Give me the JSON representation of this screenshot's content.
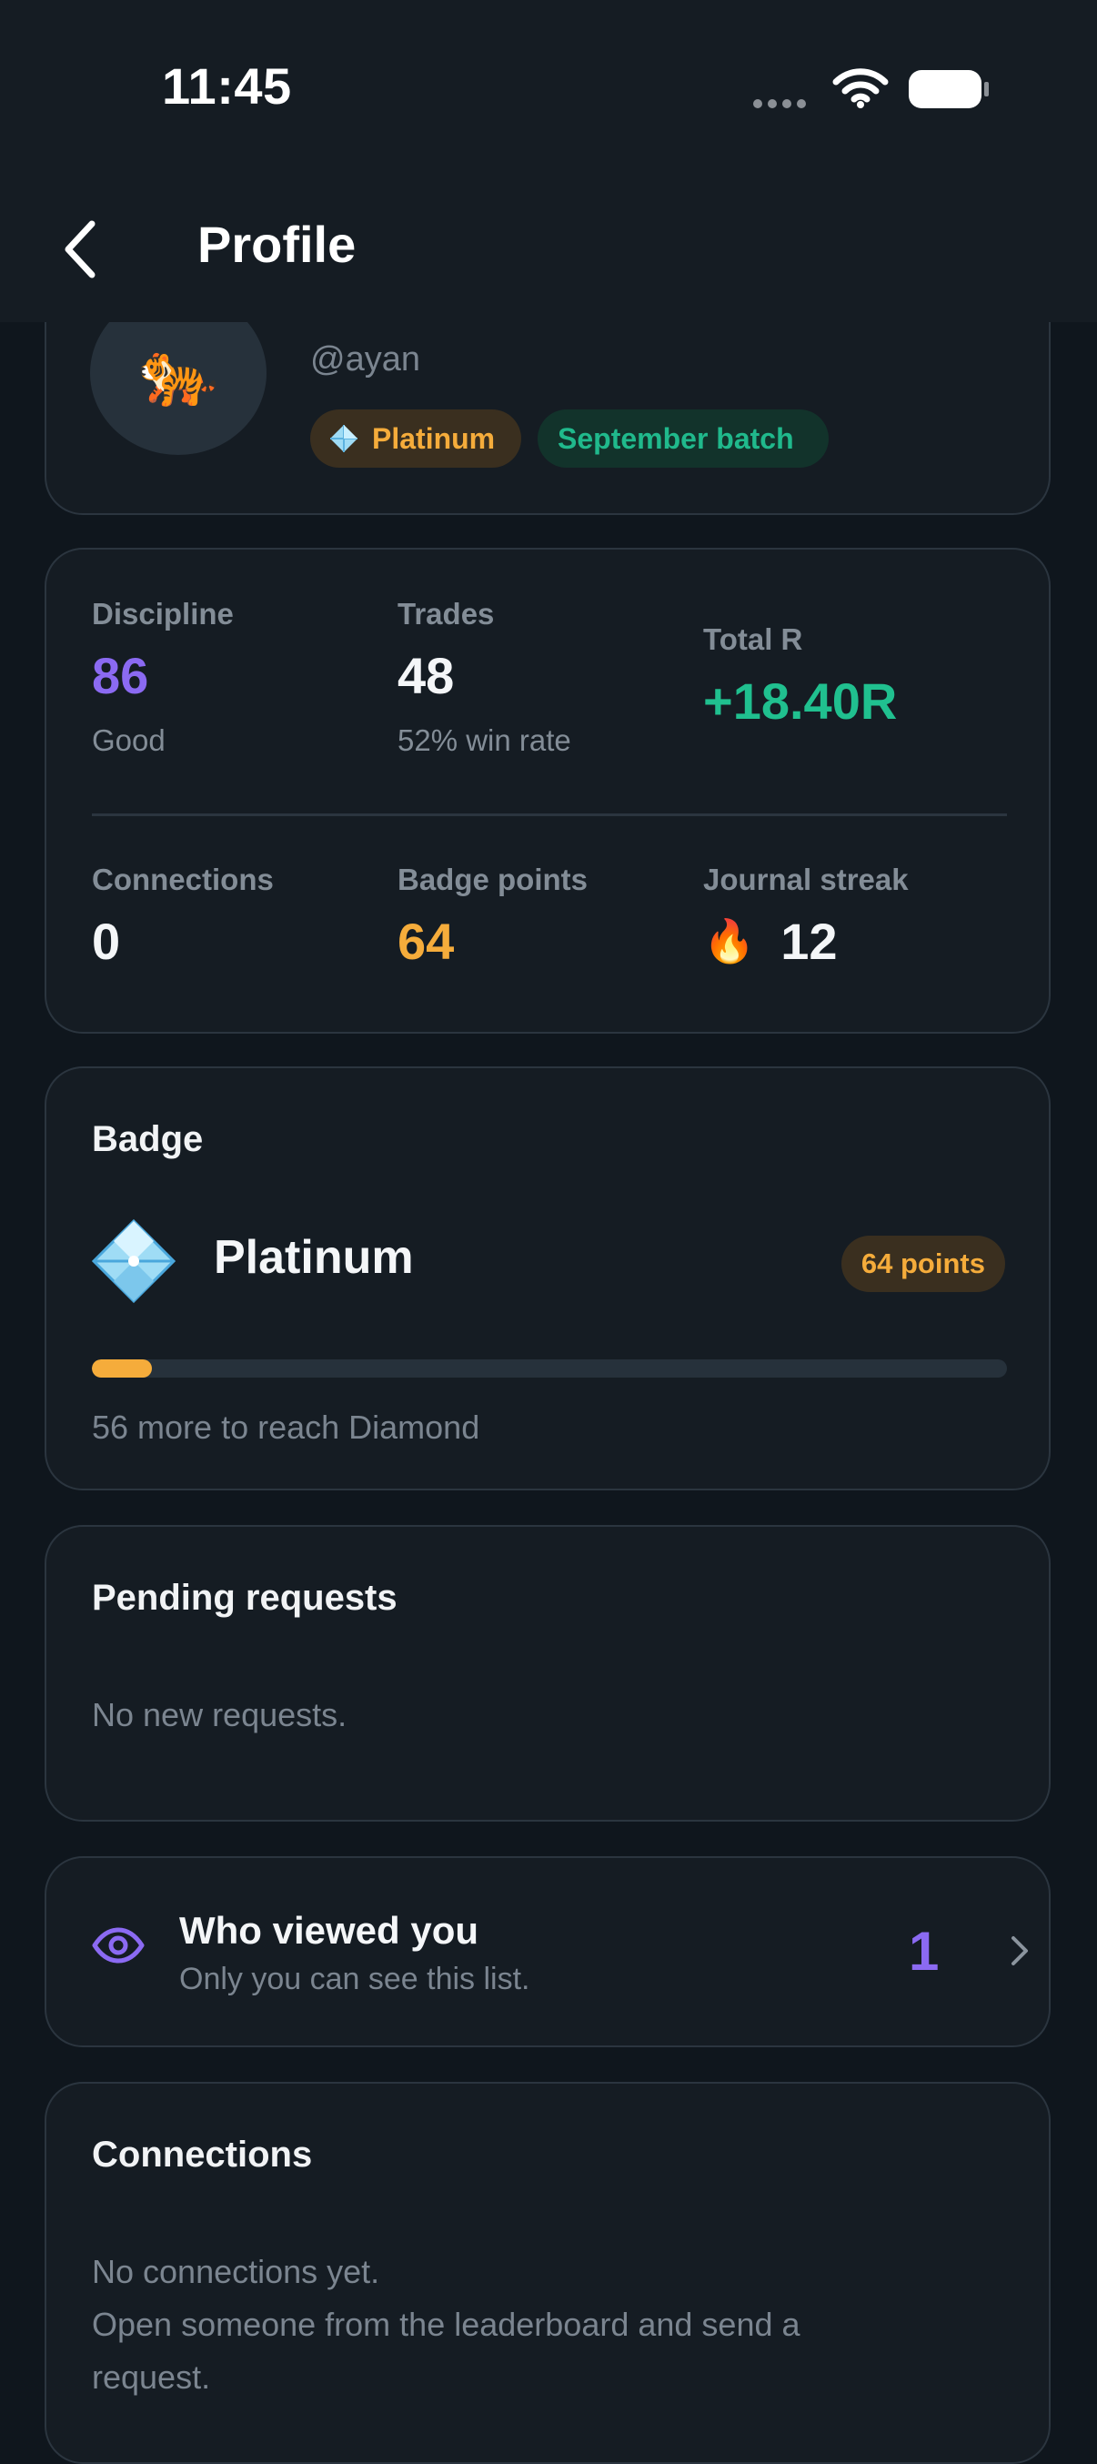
{
  "status_bar": {
    "time": "11:45",
    "icons": [
      "signal-dots-icon",
      "wifi-icon",
      "battery-icon"
    ]
  },
  "nav": {
    "back_icon": "chevron-left-icon",
    "title": "Profile"
  },
  "profile": {
    "avatar_icon": "tiger-avatar",
    "avatar_glyph": "🐅",
    "handle": "@ayan",
    "tier_label": "Platinum",
    "batch_label": "September batch"
  },
  "stats": {
    "discipline": {
      "label": "Discipline",
      "value": "86",
      "sub": "Good"
    },
    "trades": {
      "label": "Trades",
      "value": "48",
      "sub": "52% win rate"
    },
    "total_r": {
      "label": "Total R",
      "value": "+18.40R"
    },
    "connections": {
      "label": "Connections",
      "value": "0"
    },
    "badge_points": {
      "label": "Badge points",
      "value": "64"
    },
    "journal_streak": {
      "label": "Journal streak",
      "value": "12",
      "icon": "fire-icon",
      "glyph": "🔥"
    }
  },
  "badge": {
    "title": "Badge",
    "name": "Platinum",
    "points_label": "64 points",
    "progress_fraction": 0.066,
    "progress_text": "56 more to reach Diamond"
  },
  "pending": {
    "title": "Pending requests",
    "empty_text": "No new requests."
  },
  "viewed": {
    "title": "Who viewed you",
    "subtitle": "Only you can see this list.",
    "count": "1"
  },
  "connections": {
    "title": "Connections",
    "empty_line1": "No connections yet.",
    "empty_line2": "Open someone from the leaderboard and send a",
    "empty_line3": "request."
  },
  "colors": {
    "background": "#0f161d",
    "card": "#151c23",
    "purple": "#8b6af2",
    "green": "#20c08f",
    "amber": "#f5ac3b",
    "muted": "#7b8590"
  }
}
